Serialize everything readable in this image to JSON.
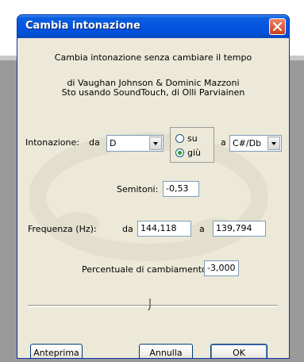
{
  "dialog": {
    "title": "Cambia intonazione",
    "description": "Cambia intonazione senza cambiare il tempo",
    "credits_line1": "di Vaughan Johnson & Dominic Mazzoni",
    "credits_line2": "Sto usando SoundTouch, di Olli Parviainen"
  },
  "pitch": {
    "label": "Intonazione:",
    "from_label": "da",
    "from_value": "D",
    "to_label": "a",
    "to_value": "C#/Db"
  },
  "direction": {
    "options": [
      {
        "label": "su",
        "selected": false
      },
      {
        "label": "giù",
        "selected": true
      }
    ]
  },
  "semitones": {
    "label": "Semitoni:",
    "value": "-0,53"
  },
  "frequency": {
    "label": "Frequenza (Hz):",
    "from_label": "da",
    "from_value": "144,118",
    "to_label": "a",
    "to_value": "139,794"
  },
  "percent": {
    "label": "Percentuale di cambiamento:",
    "value": "-3,000"
  },
  "slider": {
    "value_fraction": 0.49
  },
  "buttons": {
    "preview": "Anteprima",
    "cancel": "Annulla",
    "ok": "OK"
  },
  "icons": {
    "close": "close-icon",
    "watermark": "audacity-logo-watermark"
  },
  "colors": {
    "titlebar": "#0554e3",
    "client": "#ece9d8",
    "close": "#c9411e"
  }
}
